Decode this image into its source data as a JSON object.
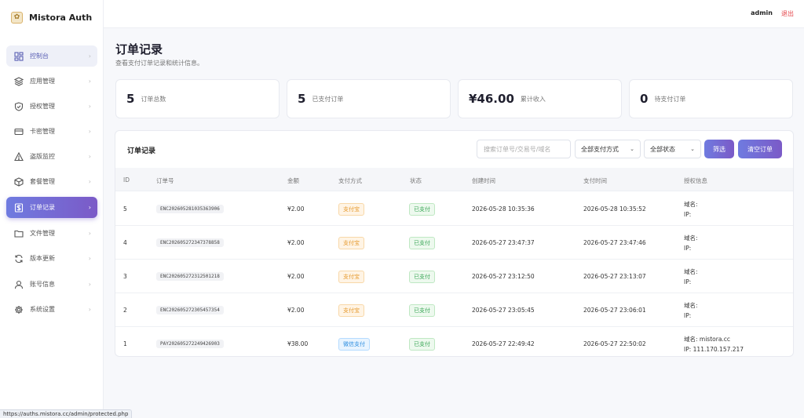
{
  "brand": {
    "name": "Mistora Auth",
    "logo": "logo-icon"
  },
  "topbar": {
    "user": "admin",
    "logout": "退出"
  },
  "sidebar": {
    "items": [
      {
        "label": "控制台",
        "icon": "dashboard-icon",
        "state": "highlight"
      },
      {
        "label": "应用管理",
        "icon": "layers-icon"
      },
      {
        "label": "授权管理",
        "icon": "shield-icon"
      },
      {
        "label": "卡密管理",
        "icon": "card-icon"
      },
      {
        "label": "盗版监控",
        "icon": "warning-icon"
      },
      {
        "label": "套餐管理",
        "icon": "box-icon"
      },
      {
        "label": "订单记录",
        "icon": "receipt-icon",
        "state": "active"
      },
      {
        "label": "文件管理",
        "icon": "folder-icon"
      },
      {
        "label": "版本更新",
        "icon": "refresh-icon"
      },
      {
        "label": "账号信息",
        "icon": "user-icon"
      },
      {
        "label": "系统设置",
        "icon": "gear-icon"
      }
    ]
  },
  "page": {
    "title": "订单记录",
    "subtitle": "查看支付订单记录和统计信息。"
  },
  "stats": [
    {
      "value": "5",
      "label": "订单总数"
    },
    {
      "value": "5",
      "label": "已支付订单"
    },
    {
      "value": "¥46.00",
      "label": "累计收入"
    },
    {
      "value": "0",
      "label": "待支付订单"
    }
  ],
  "panel": {
    "title": "订单记录",
    "search_placeholder": "搜索订单号/交易号/域名",
    "pay_method_select": "全部支付方式",
    "status_select": "全部状态",
    "filter_button": "筛选",
    "clear_button": "清空订单"
  },
  "table": {
    "columns": [
      "ID",
      "订单号",
      "金额",
      "支付方式",
      "状态",
      "创建时间",
      "支付时间",
      "授权信息"
    ],
    "rows": [
      {
        "id": "5",
        "order_no": "ENC202605281035363906",
        "amount": "¥2.00",
        "method": "支付宝",
        "status": "已支付",
        "created": "2026-05-28 10:35:36",
        "paid": "2026-05-28 10:35:52",
        "domain": "域名:",
        "ip": "IP:"
      },
      {
        "id": "4",
        "order_no": "ENC202605272347378858",
        "amount": "¥2.00",
        "method": "支付宝",
        "status": "已支付",
        "created": "2026-05-27 23:47:37",
        "paid": "2026-05-27 23:47:46",
        "domain": "域名:",
        "ip": "IP:"
      },
      {
        "id": "3",
        "order_no": "ENC202605272312501218",
        "amount": "¥2.00",
        "method": "支付宝",
        "status": "已支付",
        "created": "2026-05-27 23:12:50",
        "paid": "2026-05-27 23:13:07",
        "domain": "域名:",
        "ip": "IP:"
      },
      {
        "id": "2",
        "order_no": "ENC202605272305457354",
        "amount": "¥2.00",
        "method": "支付宝",
        "status": "已支付",
        "created": "2026-05-27 23:05:45",
        "paid": "2026-05-27 23:06:01",
        "domain": "域名:",
        "ip": "IP:"
      },
      {
        "id": "1",
        "order_no": "PAY202605272249426903",
        "amount": "¥38.00",
        "method": "微信支付",
        "status": "已支付",
        "created": "2026-05-27 22:49:42",
        "paid": "2026-05-27 22:50:02",
        "domain": "域名: mistora.cc",
        "ip": "IP: 111.170.157.217"
      }
    ]
  },
  "statusbar": {
    "url": "https://auths.mistora.cc/admin/protected.php"
  },
  "colors": {
    "accent": "#6f7be0",
    "accent2": "#7b5ac7",
    "logout": "#e5484d",
    "paid": "#3aa657",
    "alipay": "#e69a2e",
    "wechat": "#2f8fe0"
  }
}
